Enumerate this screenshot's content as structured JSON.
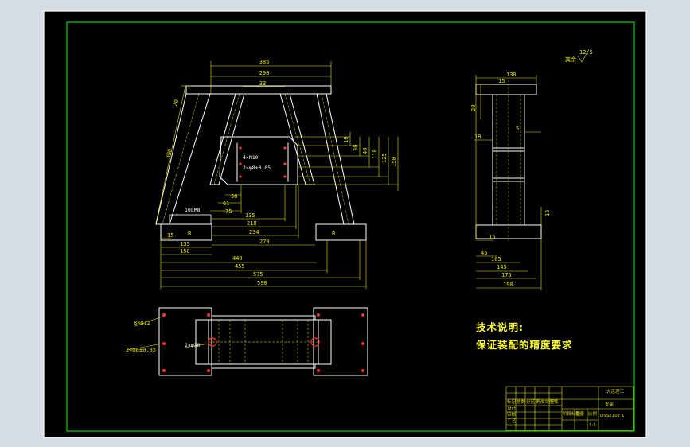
{
  "drawing": {
    "front_view": {
      "top_dims": [
        "385",
        "290",
        "33"
      ],
      "left_dims": [
        "20",
        "390"
      ],
      "weld_note": "10LM8",
      "plate_dims": [
        "4×M10",
        "2×φ8±0.05"
      ],
      "inner_dims": [
        "36",
        "61",
        "75",
        "135",
        "210",
        "234",
        "270"
      ],
      "right_dims": [
        "10",
        "30",
        "40",
        "110",
        "125",
        "150"
      ],
      "bottom_dims": [
        "15",
        "135",
        "150",
        "440",
        "455",
        "575",
        "590"
      ],
      "section_marks": [
        "B",
        "B"
      ]
    },
    "side_view": {
      "top_dims": [
        "130",
        "15"
      ],
      "left_dims": [
        "20",
        "10"
      ],
      "right_dims": [
        "5",
        "15"
      ],
      "bottom_dims": [
        "15",
        "45",
        "105",
        "145",
        "175",
        "190"
      ],
      "roughness": "12.5",
      "roughness_label": "其余"
    },
    "top_view": {
      "labels": [
        "8×φ12",
        "2×φ8±0.05",
        "2×φ30"
      ]
    },
    "notes": {
      "title": "技术说明:",
      "line1": "保证装配的精度要求"
    },
    "title_block": {
      "school": "大连理工",
      "part_name": "支架",
      "drawing_no": "DSS2107 1",
      "cells": [
        "标记",
        "处数",
        "分区",
        "更改文件号",
        "签名",
        "设计",
        "审核",
        "工艺",
        "阶段标记",
        "重量",
        "比例",
        "1:1"
      ]
    }
  }
}
